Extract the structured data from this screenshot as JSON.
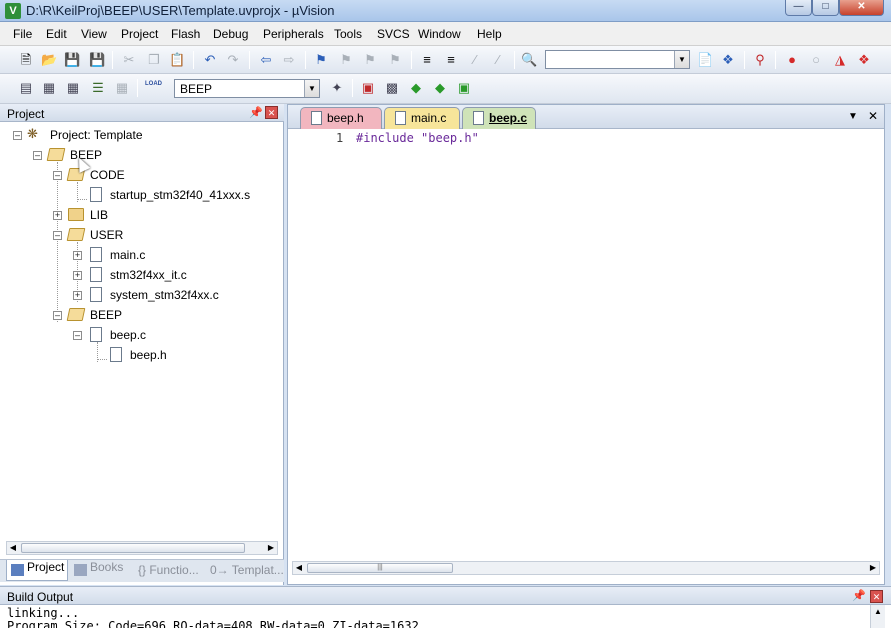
{
  "window": {
    "title": "D:\\R\\KeilProj\\BEEP\\USER\\Template.uvprojx - µVision",
    "app_icon": "V"
  },
  "menu": [
    "File",
    "Edit",
    "View",
    "Project",
    "Flash",
    "Debug",
    "Peripherals",
    "Tools",
    "SVCS",
    "Window",
    "Help"
  ],
  "toolbar2": {
    "target": "BEEP",
    "load_label": "LOAD"
  },
  "project_panel": {
    "title": "Project",
    "tree": [
      {
        "label": "Project: Template",
        "level": 0
      },
      {
        "label": "BEEP",
        "level": 1
      },
      {
        "label": "CODE",
        "level": 2
      },
      {
        "label": "startup_stm32f40_41xxx.s",
        "level": 3
      },
      {
        "label": "LIB",
        "level": 2
      },
      {
        "label": "USER",
        "level": 2
      },
      {
        "label": "main.c",
        "level": 3
      },
      {
        "label": "stm32f4xx_it.c",
        "level": 3
      },
      {
        "label": "system_stm32f4xx.c",
        "level": 3
      },
      {
        "label": "BEEP",
        "level": 2
      },
      {
        "label": "beep.c",
        "level": 3
      },
      {
        "label": "beep.h",
        "level": 4
      }
    ],
    "tabs": [
      "Project",
      "Books",
      "{} Functio...",
      "0→ Templat..."
    ]
  },
  "editor": {
    "tabs": [
      "beep.h",
      "main.c",
      "beep.c"
    ],
    "active_tab": "beep.c",
    "lines": [
      {
        "num": "1",
        "directive": "#include",
        "string": "\"beep.h\""
      }
    ]
  },
  "build_output": {
    "title": "Build Output",
    "lines": [
      "linking...",
      "Program Size: Code=696 RO-data=408 RW-data=0 ZI-data=1632"
    ]
  },
  "colors": {
    "tab_beeph": "#f2b6bf",
    "tab_mainc": "#f7e59a",
    "tab_beepc": "#cfe3b8",
    "directive": "#6a2a9a"
  }
}
